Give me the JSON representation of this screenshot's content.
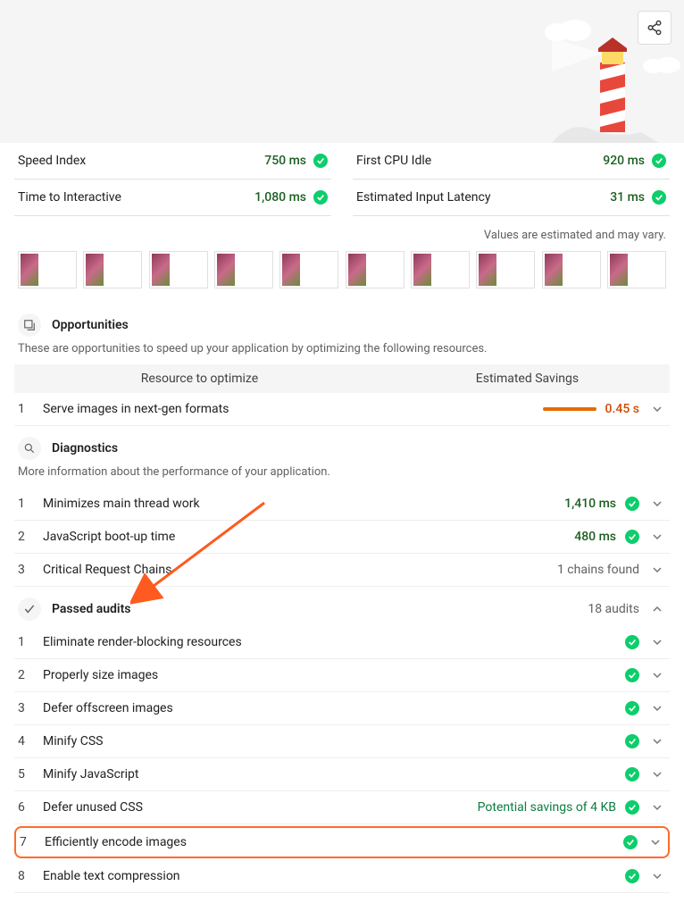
{
  "header": {
    "share_label": "Share"
  },
  "metrics": {
    "row1": [
      {
        "label": "Speed Index",
        "value": "750 ms"
      },
      {
        "label": "First CPU Idle",
        "value": "920 ms"
      }
    ],
    "row2": [
      {
        "label": "Time to Interactive",
        "value": "1,080 ms"
      },
      {
        "label": "Estimated Input Latency",
        "value": "31 ms"
      }
    ],
    "note": "Values are estimated and may vary."
  },
  "filmstrip_frames": 10,
  "opportunities": {
    "title": "Opportunities",
    "desc": "These are opportunities to speed up your application by optimizing the following resources.",
    "col_resource": "Resource to optimize",
    "col_savings": "Estimated Savings",
    "items": [
      {
        "num": "1",
        "title": "Serve images in next-gen formats",
        "value": "0.45 s",
        "bar": true
      }
    ]
  },
  "diagnostics": {
    "title": "Diagnostics",
    "desc": "More information about the performance of your application.",
    "items": [
      {
        "num": "1",
        "title": "Minimizes main thread work",
        "value": "1,410 ms",
        "pass": true
      },
      {
        "num": "2",
        "title": "JavaScript boot-up time",
        "value": "480 ms",
        "pass": true
      },
      {
        "num": "3",
        "title": "Critical Request Chains",
        "value": "1 chains found",
        "gray": true
      }
    ]
  },
  "passed": {
    "title": "Passed audits",
    "count": "18 audits",
    "items": [
      {
        "num": "1",
        "title": "Eliminate render-blocking resources"
      },
      {
        "num": "2",
        "title": "Properly size images"
      },
      {
        "num": "3",
        "title": "Defer offscreen images"
      },
      {
        "num": "4",
        "title": "Minify CSS"
      },
      {
        "num": "5",
        "title": "Minify JavaScript"
      },
      {
        "num": "6",
        "title": "Defer unused CSS",
        "extra": "Potential savings of 4 KB"
      },
      {
        "num": "7",
        "title": "Efficiently encode images",
        "highlight": true
      },
      {
        "num": "8",
        "title": "Enable text compression"
      }
    ]
  }
}
